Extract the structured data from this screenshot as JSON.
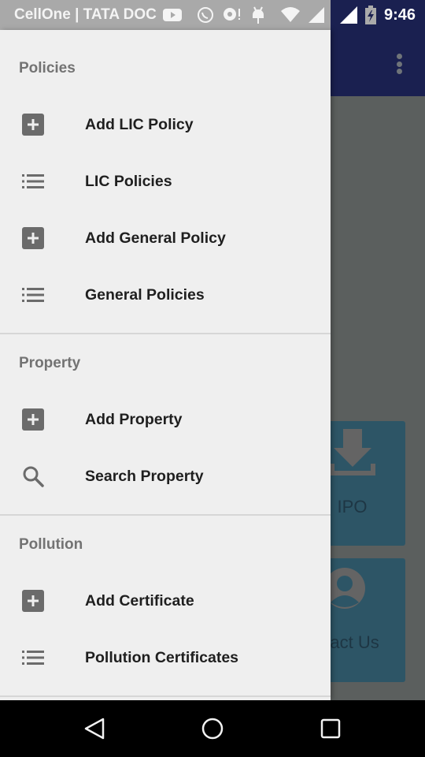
{
  "status_bar": {
    "carrier": "CellOne | TATA DOC",
    "time": "9:46",
    "icons": [
      "youtube-icon",
      "whatsapp-icon",
      "chat-alert-icon",
      "android-icon",
      "wifi-icon",
      "signal-icon",
      "signal-icon",
      "battery-charging-icon"
    ]
  },
  "background_app": {
    "toolbar_color": "#1a2050",
    "overflow_icon": "more-vert-icon",
    "tiles": [
      {
        "label": "IPO",
        "icon": "download-icon"
      },
      {
        "label": "tact Us",
        "icon": "contact-icon"
      }
    ]
  },
  "drawer": {
    "sections": [
      {
        "header": "Policies",
        "items": [
          {
            "label": "Add LIC Policy",
            "icon": "add-box-icon"
          },
          {
            "label": "LIC Policies",
            "icon": "list-icon"
          },
          {
            "label": "Add General Policy",
            "icon": "add-box-icon"
          },
          {
            "label": "General Policies",
            "icon": "list-icon"
          }
        ]
      },
      {
        "header": "Property",
        "items": [
          {
            "label": "Add Property",
            "icon": "add-box-icon"
          },
          {
            "label": "Search Property",
            "icon": "search-icon"
          }
        ]
      },
      {
        "header": "Pollution",
        "items": [
          {
            "label": "Add Certificate",
            "icon": "add-box-icon"
          },
          {
            "label": "Pollution Certificates",
            "icon": "list-icon"
          }
        ]
      }
    ]
  },
  "nav_bar": {
    "buttons": [
      "back",
      "home",
      "recents"
    ]
  }
}
